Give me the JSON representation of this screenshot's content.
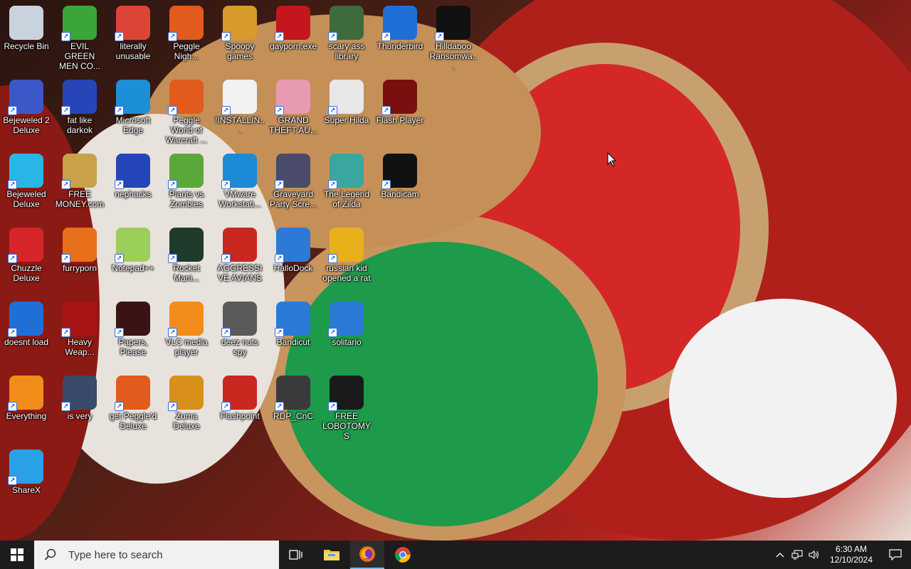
{
  "desktop": {
    "icons": [
      {
        "label": "Recycle Bin",
        "icon": "recycle-bin-icon",
        "color": "#c9d3dd"
      },
      {
        "label": "EVIL GREEN MEN CO...",
        "icon": "green-people-icon",
        "color": "#3aa63a"
      },
      {
        "label": "literally unusable",
        "icon": "chrome-icon",
        "color": "#db4437"
      },
      {
        "label": "Peggle Nigh...",
        "icon": "peggle-icon",
        "color": "#e25a1c"
      },
      {
        "label": "Spoopy games",
        "icon": "folder-icon",
        "color": "#d89a2a"
      },
      {
        "label": "gayporn.exe",
        "icon": "flash-icon",
        "color": "#c4161c"
      },
      {
        "label": "scary ass library",
        "icon": "library-icon",
        "color": "#3d6b3d"
      },
      {
        "label": "Thunderbird",
        "icon": "thunderbird-icon",
        "color": "#1f6fd6"
      },
      {
        "label": "Hilldaboo Ransomwa...",
        "icon": "yashma-icon",
        "color": "#111111"
      },
      {
        "label": "Bejeweled 2 Deluxe",
        "icon": "bejeweled2-icon",
        "color": "#3c58c8"
      },
      {
        "label": "fat like darkok",
        "icon": "mpi-icon",
        "color": "#2645b8"
      },
      {
        "label": "Microsoft Edge",
        "icon": "edge-icon",
        "color": "#1d8fd8"
      },
      {
        "label": "Peggle World of Warcraft ...",
        "icon": "peggle-icon",
        "color": "#e25a1c"
      },
      {
        "label": "!INSTALLIN...",
        "icon": "document-icon",
        "color": "#f2f2f2"
      },
      {
        "label": "GRAND THEFT AU...",
        "icon": "anime-girl-icon",
        "color": "#e79ab0"
      },
      {
        "label": "Super Hilda",
        "icon": "pixel-character-icon",
        "color": "#e8e8e8"
      },
      {
        "label": "Flash Player",
        "icon": "flash-icon",
        "color": "#7a0f0f"
      },
      {
        "label": "Bejeweled Deluxe",
        "icon": "diamond-icon",
        "color": "#27b6e6"
      },
      {
        "label": "FREE MONEY.com",
        "icon": "money-bag-icon",
        "color": "#c8a14a"
      },
      {
        "label": "nephacks",
        "icon": "mpi-icon",
        "color": "#2645b8"
      },
      {
        "label": "Plants vs Zombies",
        "icon": "plant-icon",
        "color": "#5aa83a"
      },
      {
        "label": "VMware Workstati...",
        "icon": "vmware-icon",
        "color": "#1c8ad6"
      },
      {
        "label": "Graveyard Party Scre...",
        "icon": "graveyard-icon",
        "color": "#4a4a6a"
      },
      {
        "label": "The Legend of Zilda",
        "icon": "zilda-icon",
        "color": "#3aa6a0"
      },
      {
        "label": "Bandicam",
        "icon": "record-icon",
        "color": "#111111"
      },
      {
        "label": "Chuzzle Deluxe",
        "icon": "chuzzle-icon",
        "color": "#d6262a"
      },
      {
        "label": "furryporn",
        "icon": "firefox-icon",
        "color": "#e8701a"
      },
      {
        "label": "Notepad++",
        "icon": "notepad-plus-icon",
        "color": "#9ccf5a"
      },
      {
        "label": "Rocket Mani...",
        "icon": "rocket-icon",
        "color": "#1f3a2a"
      },
      {
        "label": "AGGRESSIVE AVIANS",
        "icon": "angry-bird-icon",
        "color": "#c8281f"
      },
      {
        "label": "HalloDock",
        "icon": "windows-shield-icon",
        "color": "#2d7ad6"
      },
      {
        "label": "russian kid opened a rat",
        "icon": "de-icon",
        "color": "#e8b01a"
      },
      {
        "label": "doesnt load",
        "icon": "thunderbird-icon",
        "color": "#1f6fd6"
      },
      {
        "label": "Heavy Weap...",
        "icon": "radiation-icon",
        "color": "#a81414"
      },
      {
        "label": "Papers, Please",
        "icon": "papers-please-icon",
        "color": "#3a1414"
      },
      {
        "label": "VLC media player",
        "icon": "vlc-icon",
        "color": "#f28c1a"
      },
      {
        "label": "deez nuts spy",
        "icon": "stack-icon",
        "color": "#5a5a5a"
      },
      {
        "label": "Bandicut",
        "icon": "bandicut-icon",
        "color": "#2a7ad6"
      },
      {
        "label": "solitario",
        "icon": "cards-icon",
        "color": "#2a7ad6"
      },
      {
        "label": "Everything",
        "icon": "magnifier-icon",
        "color": "#f28c1a"
      },
      {
        "label": "is very",
        "icon": "mpi-shield-icon",
        "color": "#3a4a6a"
      },
      {
        "label": "get Peggle'd Deluxe",
        "icon": "peggle-icon",
        "color": "#e25a1c"
      },
      {
        "label": "Zuma Deluxe",
        "icon": "zuma-icon",
        "color": "#d8901a"
      },
      {
        "label": "Flashpoint",
        "icon": "flashpoint-icon",
        "color": "#c8281f"
      },
      {
        "label": "RDP_CnC",
        "icon": "rdp-icon",
        "color": "#3a3a3a"
      },
      {
        "label": "FREE LOBOTOMYS",
        "icon": "lobotomy-icon",
        "color": "#1a1a1a"
      },
      {
        "label": "ShareX",
        "icon": "sharex-icon",
        "color": "#2aa0e8"
      }
    ]
  },
  "taskbar": {
    "search_placeholder": "Type here to search",
    "apps": [
      {
        "name": "task-view-button",
        "icon": "task-view-icon"
      },
      {
        "name": "file-explorer-button",
        "icon": "folder-icon"
      },
      {
        "name": "firefox-button",
        "icon": "firefox-icon"
      },
      {
        "name": "chrome-button",
        "icon": "chrome-icon"
      }
    ],
    "clock": {
      "time": "6:30 AM",
      "date": "12/10/2024"
    }
  }
}
